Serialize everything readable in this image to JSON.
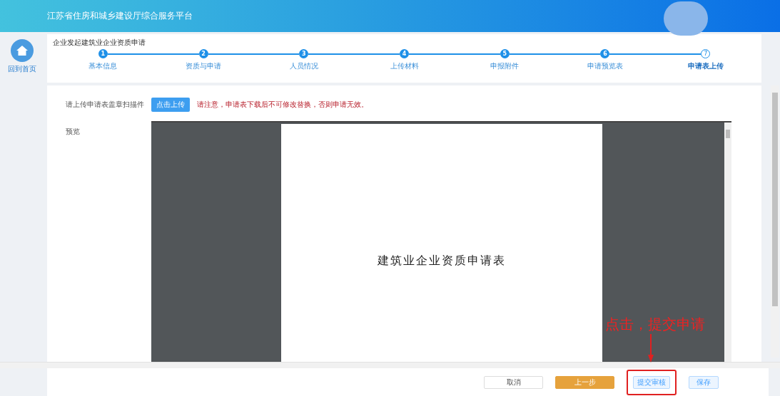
{
  "header": {
    "title": "江苏省住房和城乡建设厅综合服务平台"
  },
  "sidebar": {
    "home_label": "回到首页"
  },
  "steps": {
    "title": "企业发起建筑业企业资质申请",
    "items": [
      {
        "number": "1",
        "label": "基本信息",
        "selected": false
      },
      {
        "number": "2",
        "label": "资质与申请",
        "selected": false
      },
      {
        "number": "3",
        "label": "人员情况",
        "selected": false
      },
      {
        "number": "4",
        "label": "上传材料",
        "selected": false
      },
      {
        "number": "5",
        "label": "申报附件",
        "selected": false
      },
      {
        "number": "6",
        "label": "申请预览表",
        "selected": false
      },
      {
        "number": "7",
        "label": "申请表上传",
        "selected": true
      }
    ]
  },
  "upload": {
    "label": "请上传申请表盖章扫描件",
    "button": "点击上传",
    "notice": "请注意，申请表下载后不可修改替换，否则申请无效。"
  },
  "preview": {
    "label": "预览",
    "document_title": "建筑业企业资质申请表"
  },
  "annotation": {
    "text": "点击，提交申请"
  },
  "buttons": [
    {
      "label": "取消",
      "kind": "plain",
      "highlighted": false
    },
    {
      "label": "上一步",
      "kind": "warning",
      "highlighted": false
    },
    {
      "label": "提交审核",
      "kind": "light",
      "highlighted": true
    },
    {
      "label": "保存",
      "kind": "light",
      "highlighted": false
    }
  ]
}
